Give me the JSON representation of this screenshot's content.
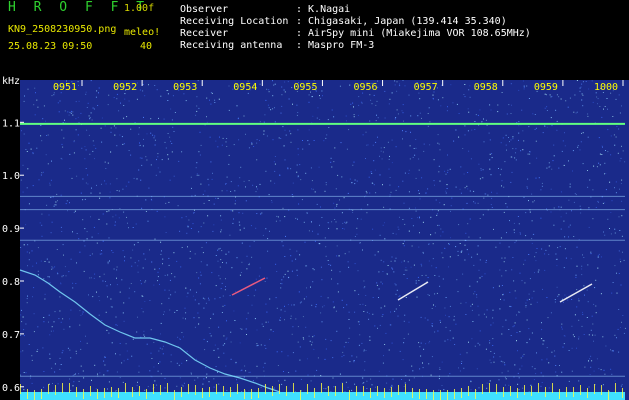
{
  "header": {
    "brand": "H R O F F T",
    "version": "1.00f",
    "filename": "KN9_2508230950.png",
    "timestamp": "25.08.23 09:50",
    "param_label": "meleo!",
    "param_value": "40",
    "info": [
      {
        "key": "Observer",
        "value": ": K.Nagai"
      },
      {
        "key": "Receiving Location",
        "value": ": Chigasaki, Japan (139.414 35.340)"
      },
      {
        "key": "Receiver",
        "value": ": AirSpy mini (Miakejima VOR 108.65MHz)"
      },
      {
        "key": "Receiving antenna",
        "value": ": Maspro FM-3"
      }
    ]
  },
  "spectrogram": {
    "y_unit": "kHz",
    "x_ticks": [
      "0951",
      "0952",
      "0953",
      "0954",
      "0955",
      "0956",
      "0957",
      "0958",
      "0959",
      "1000"
    ],
    "y_ticks": [
      "1.1",
      "1.0",
      "0.9",
      "0.8",
      "0.7",
      "0.6"
    ],
    "y_tick_values": [
      1.1,
      1.0,
      0.9,
      0.8,
      0.7,
      0.6
    ],
    "y_range": [
      0.575,
      1.18
    ],
    "colors": {
      "background": "#1a2a8a",
      "carrier": "#60ff80",
      "noise": "#6ea8ff",
      "tick_text": "#ffff00",
      "label_text": "#ffffff",
      "baseline": "#40e0ff"
    }
  }
}
